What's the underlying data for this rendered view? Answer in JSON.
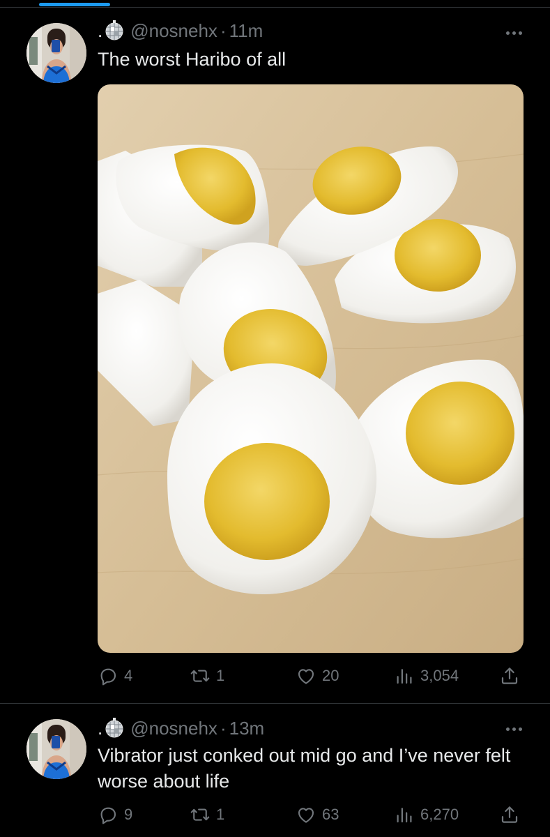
{
  "tweets": [
    {
      "name_prefix": ".",
      "handle": "@nosnehx",
      "time": "11m",
      "text": "The worst Haribo of all",
      "has_media": true,
      "actions": {
        "replies": "4",
        "reposts": "1",
        "likes": "20",
        "views": "3,054"
      }
    },
    {
      "name_prefix": ".",
      "handle": "@nosnehx",
      "time": "13m",
      "text": "Vibrator just conked out mid go and I’ve never felt worse about life",
      "has_media": false,
      "actions": {
        "replies": "9",
        "reposts": "1",
        "likes": "63",
        "views": "6,270"
      }
    }
  ],
  "colors": {
    "accent": "#1d9bf0",
    "muted": "#71767b",
    "text": "#e7e9ea",
    "divider": "#2f3336"
  },
  "icons": [
    "reply-icon",
    "repost-icon",
    "like-icon",
    "views-icon",
    "share-icon",
    "more-icon",
    "disco-ball-icon"
  ]
}
